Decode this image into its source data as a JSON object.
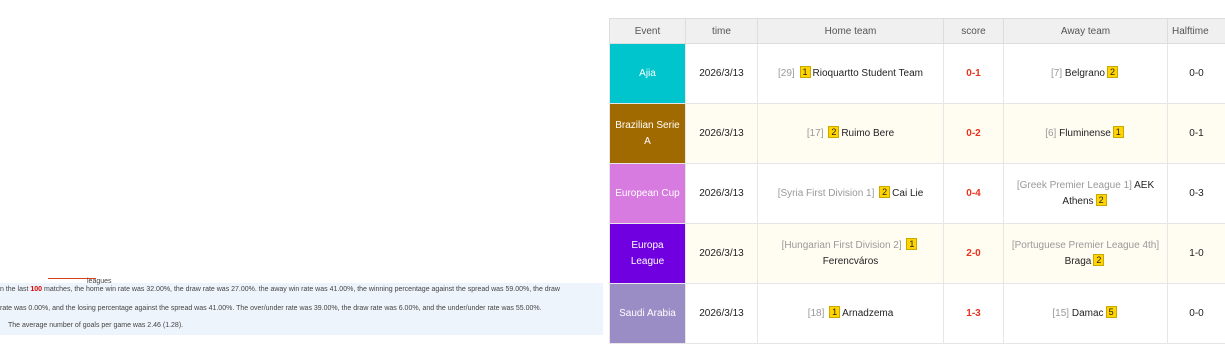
{
  "stats": {
    "tab_label": "leagues",
    "line1_pre": "n the last ",
    "line1_num": "100",
    "line1_post": " matches, the home win rate was 32.00%, the draw rate was 27.00%.      the away win rate was 41.00%, the winning percentage against the spread was 59.00%, the draw",
    "line2": "rate was 0.00%, and the losing percentage against the spread was 41.00%.     The over/under rate was 39.00%, the draw rate was 6.00%, and the under/under rate was 55.00%.",
    "line3": "The average number of goals per game was 2.46 (1.28)."
  },
  "table": {
    "headers": {
      "event": "Event",
      "time": "time",
      "home": "Home team",
      "score": "score",
      "away": "Away team",
      "halftime": "Halftime"
    },
    "rows": [
      {
        "event": "Ajia",
        "event_color": "#00c5cd",
        "time": "2026/3/13",
        "home_rank": "[29]",
        "home_badge": "1",
        "home_name": "Rioquartto Student Team",
        "score": "0-1",
        "away_rank": "[7]",
        "away_name": "Belgrano",
        "away_badge": "2",
        "halftime": "0-0"
      },
      {
        "event": "Brazilian Serie A",
        "event_color": "#a06a00",
        "time": "2026/3/13",
        "home_rank": "[17]",
        "home_badge": "2",
        "home_name": "Ruimo Bere",
        "score": "0-2",
        "away_rank": "[6]",
        "away_name": "Fluminense",
        "away_badge": "1",
        "halftime": "0-1"
      },
      {
        "event": "European Cup",
        "event_color": "#d77be0",
        "time": "2026/3/13",
        "home_rank": "[Syria First Division 1]",
        "home_badge": "2",
        "home_name": "Cai Lie",
        "score": "0-4",
        "away_rank": "[Greek Premier League 1]",
        "away_name": "AEK Athens",
        "away_badge": "2",
        "halftime": "0-3"
      },
      {
        "event": "Europa League",
        "event_color": "#7000e0",
        "time": "2026/3/13",
        "home_rank": "[Hungarian First Division 2]",
        "home_badge": "1",
        "home_name": "Ferencváros",
        "score": "2-0",
        "away_rank": "[Portuguese Premier League 4th]",
        "away_name": "Braga",
        "away_badge": "2",
        "halftime": "1-0"
      },
      {
        "event": "Saudi Arabia",
        "event_color": "#9a8cc4",
        "time": "2026/3/13",
        "home_rank": "[18]",
        "home_badge": "1",
        "home_name": "Arnadzema",
        "score": "1-3",
        "away_rank": "[15]",
        "away_name": "Damac",
        "away_badge": "5",
        "halftime": "0-0"
      }
    ]
  }
}
